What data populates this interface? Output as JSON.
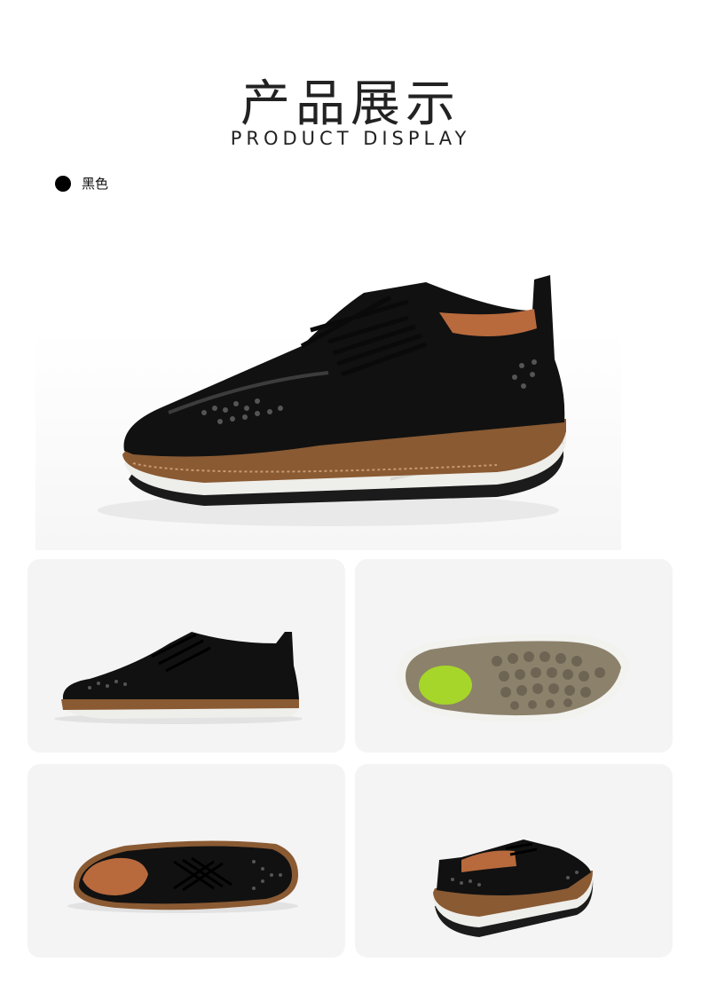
{
  "header": {
    "title_zh": "产品展示",
    "title_en": "PRODUCT DISPLAY"
  },
  "color_option": {
    "label": "黑色",
    "swatch_color": "#000000"
  },
  "images": [
    {
      "icon": "shoe-hero-angled-view"
    },
    {
      "icon": "shoe-side-view"
    },
    {
      "icon": "shoe-sole-view"
    },
    {
      "icon": "shoe-top-view"
    },
    {
      "icon": "shoe-rear-view"
    }
  ],
  "palette": {
    "leather": "#111111",
    "welt": "#8a5a33",
    "midsole": "#eeeeea",
    "outsole": "#1b1b1b",
    "lining": "#b86a3d",
    "sole_green": "#a6d62a",
    "sole_taupe": "#8c816b"
  }
}
